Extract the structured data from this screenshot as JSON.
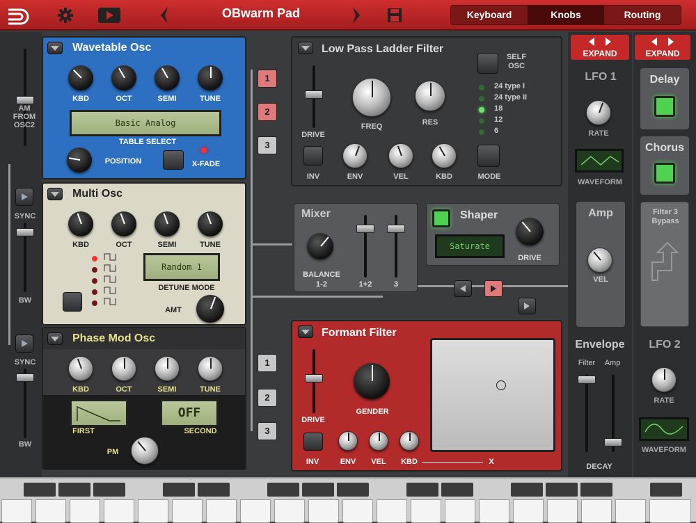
{
  "header": {
    "title": "OBwarm Pad",
    "tabs": [
      {
        "label": "Keyboard",
        "active": false
      },
      {
        "label": "Knobs",
        "active": true
      },
      {
        "label": "Routing",
        "active": false
      }
    ]
  },
  "left_strip": {
    "am_label": "AM\nFROM\nOSC2",
    "sync1": "SYNC",
    "bw1": "BW",
    "sync2": "SYNC",
    "bw2": "BW"
  },
  "wavetable": {
    "title": "Wavetable Osc",
    "knobs": [
      "KBD",
      "OCT",
      "SEMI",
      "TUNE"
    ],
    "lcd": "Basic Analog",
    "table_select": "TABLE SELECT",
    "position": "POSITION",
    "xfade": "X-FADE"
  },
  "multi": {
    "title": "Multi Osc",
    "knobs": [
      "KBD",
      "OCT",
      "SEMI",
      "TUNE"
    ],
    "lcd": "Random 1",
    "detune_mode": "DETUNE MODE",
    "amt": "AMT"
  },
  "phase": {
    "title": "Phase Mod Osc",
    "knobs": [
      "KBD",
      "OCT",
      "SEMI",
      "TUNE"
    ],
    "first": "FIRST",
    "second": "SECOND",
    "second_lcd": "OFF",
    "pm": "PM"
  },
  "routing_buttons": {
    "top": [
      "1",
      "2",
      "3"
    ],
    "bottom": [
      "1",
      "2",
      "3"
    ]
  },
  "lpf": {
    "title": "Low Pass Ladder Filter",
    "self_osc": "SELF\nOSC",
    "drive": "DRIVE",
    "freq": "FREQ",
    "res": "RES",
    "types": [
      "24 type I",
      "24 type II",
      "18",
      "12",
      "6"
    ],
    "inv": "INV",
    "env": "ENV",
    "vel": "VEL",
    "kbd": "KBD",
    "mode": "MODE"
  },
  "mixer": {
    "title": "Mixer",
    "balance": "BALANCE",
    "balance_sub": "1-2",
    "ch12": "1+2",
    "ch3": "3"
  },
  "shaper": {
    "title": "Shaper",
    "lcd": "Saturate",
    "drive": "DRIVE"
  },
  "formant": {
    "title": "Formant Filter",
    "drive": "DRIVE",
    "gender": "GENDER",
    "inv": "INV",
    "env": "ENV",
    "vel": "VEL",
    "kbd": "KBD",
    "x": "X"
  },
  "lfo1": {
    "expand": "EXPAND",
    "title": "LFO 1",
    "rate": "RATE",
    "waveform": "WAVEFORM"
  },
  "amp": {
    "title": "Amp",
    "vel": "VEL"
  },
  "envelope": {
    "title": "Envelope",
    "filter": "Filter",
    "amp": "Amp",
    "decay": "DECAY"
  },
  "fx": {
    "expand": "EXPAND",
    "delay": "Delay",
    "chorus": "Chorus",
    "filter3": "Filter 3\nBypass"
  },
  "lfo2": {
    "title": "LFO 2",
    "rate": "RATE",
    "waveform": "WAVEFORM"
  }
}
